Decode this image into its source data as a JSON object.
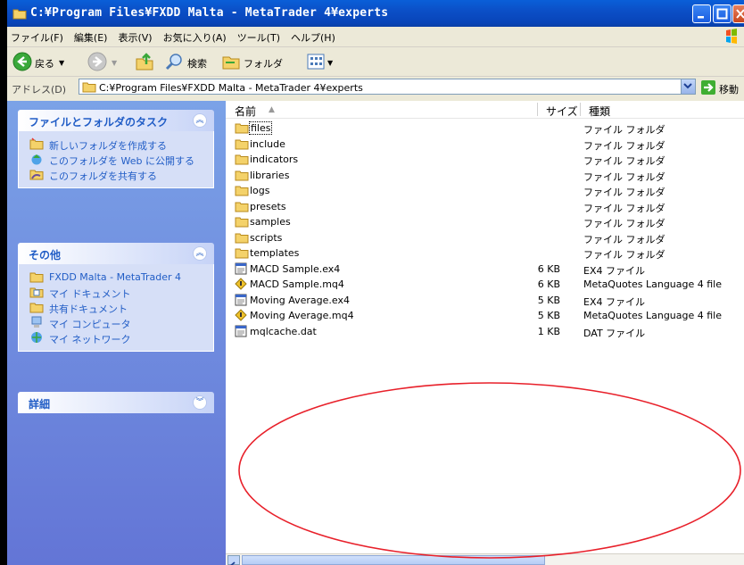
{
  "window": {
    "title": "C:¥Program Files¥FXDD Malta - MetaTrader 4¥experts"
  },
  "menu": {
    "items": [
      "ファイル(F)",
      "編集(E)",
      "表示(V)",
      "お気に入り(A)",
      "ツール(T)",
      "ヘルプ(H)"
    ]
  },
  "toolbar": {
    "back_label": "戻る",
    "search_label": "検索",
    "folders_label": "フォルダ"
  },
  "address": {
    "label": "アドレス(D)",
    "value": "C:¥Program Files¥FXDD Malta - MetaTrader 4¥experts",
    "go_label": "移動"
  },
  "sidebar": {
    "tasks": {
      "title": "ファイルとフォルダのタスク",
      "items": [
        "新しいフォルダを作成する",
        "このフォルダを Web に公開する",
        "このフォルダを共有する"
      ]
    },
    "other": {
      "title": "その他",
      "items": [
        "FXDD Malta - MetaTrader 4",
        "マイ ドキュメント",
        "共有ドキュメント",
        "マイ コンピュータ",
        "マイ ネットワーク"
      ]
    },
    "details": {
      "title": "詳細"
    }
  },
  "columns": {
    "name": "名前",
    "size": "サイズ",
    "type": "種類"
  },
  "files": [
    {
      "name": "files",
      "size": "",
      "type": "ファイル フォルダ",
      "kind": "folder"
    },
    {
      "name": "include",
      "size": "",
      "type": "ファイル フォルダ",
      "kind": "folder"
    },
    {
      "name": "indicators",
      "size": "",
      "type": "ファイル フォルダ",
      "kind": "folder"
    },
    {
      "name": "libraries",
      "size": "",
      "type": "ファイル フォルダ",
      "kind": "folder"
    },
    {
      "name": "logs",
      "size": "",
      "type": "ファイル フォルダ",
      "kind": "folder"
    },
    {
      "name": "presets",
      "size": "",
      "type": "ファイル フォルダ",
      "kind": "folder"
    },
    {
      "name": "samples",
      "size": "",
      "type": "ファイル フォルダ",
      "kind": "folder"
    },
    {
      "name": "scripts",
      "size": "",
      "type": "ファイル フォルダ",
      "kind": "folder"
    },
    {
      "name": "templates",
      "size": "",
      "type": "ファイル フォルダ",
      "kind": "folder"
    },
    {
      "name": "MACD Sample.ex4",
      "size": "6 KB",
      "type": "EX4 ファイル",
      "kind": "ex4"
    },
    {
      "name": "MACD Sample.mq4",
      "size": "6 KB",
      "type": "MetaQuotes Language 4 file",
      "kind": "mq4"
    },
    {
      "name": "Moving Average.ex4",
      "size": "5 KB",
      "type": "EX4 ファイル",
      "kind": "ex4"
    },
    {
      "name": "Moving Average.mq4",
      "size": "5 KB",
      "type": "MetaQuotes Language 4 file",
      "kind": "mq4"
    },
    {
      "name": "mqlcache.dat",
      "size": "1 KB",
      "type": "DAT ファイル",
      "kind": "dat"
    }
  ],
  "colors": {
    "titlebar": "#0a5fd8",
    "sidebar_link": "#215dc6",
    "annotation": "#e8202a"
  }
}
